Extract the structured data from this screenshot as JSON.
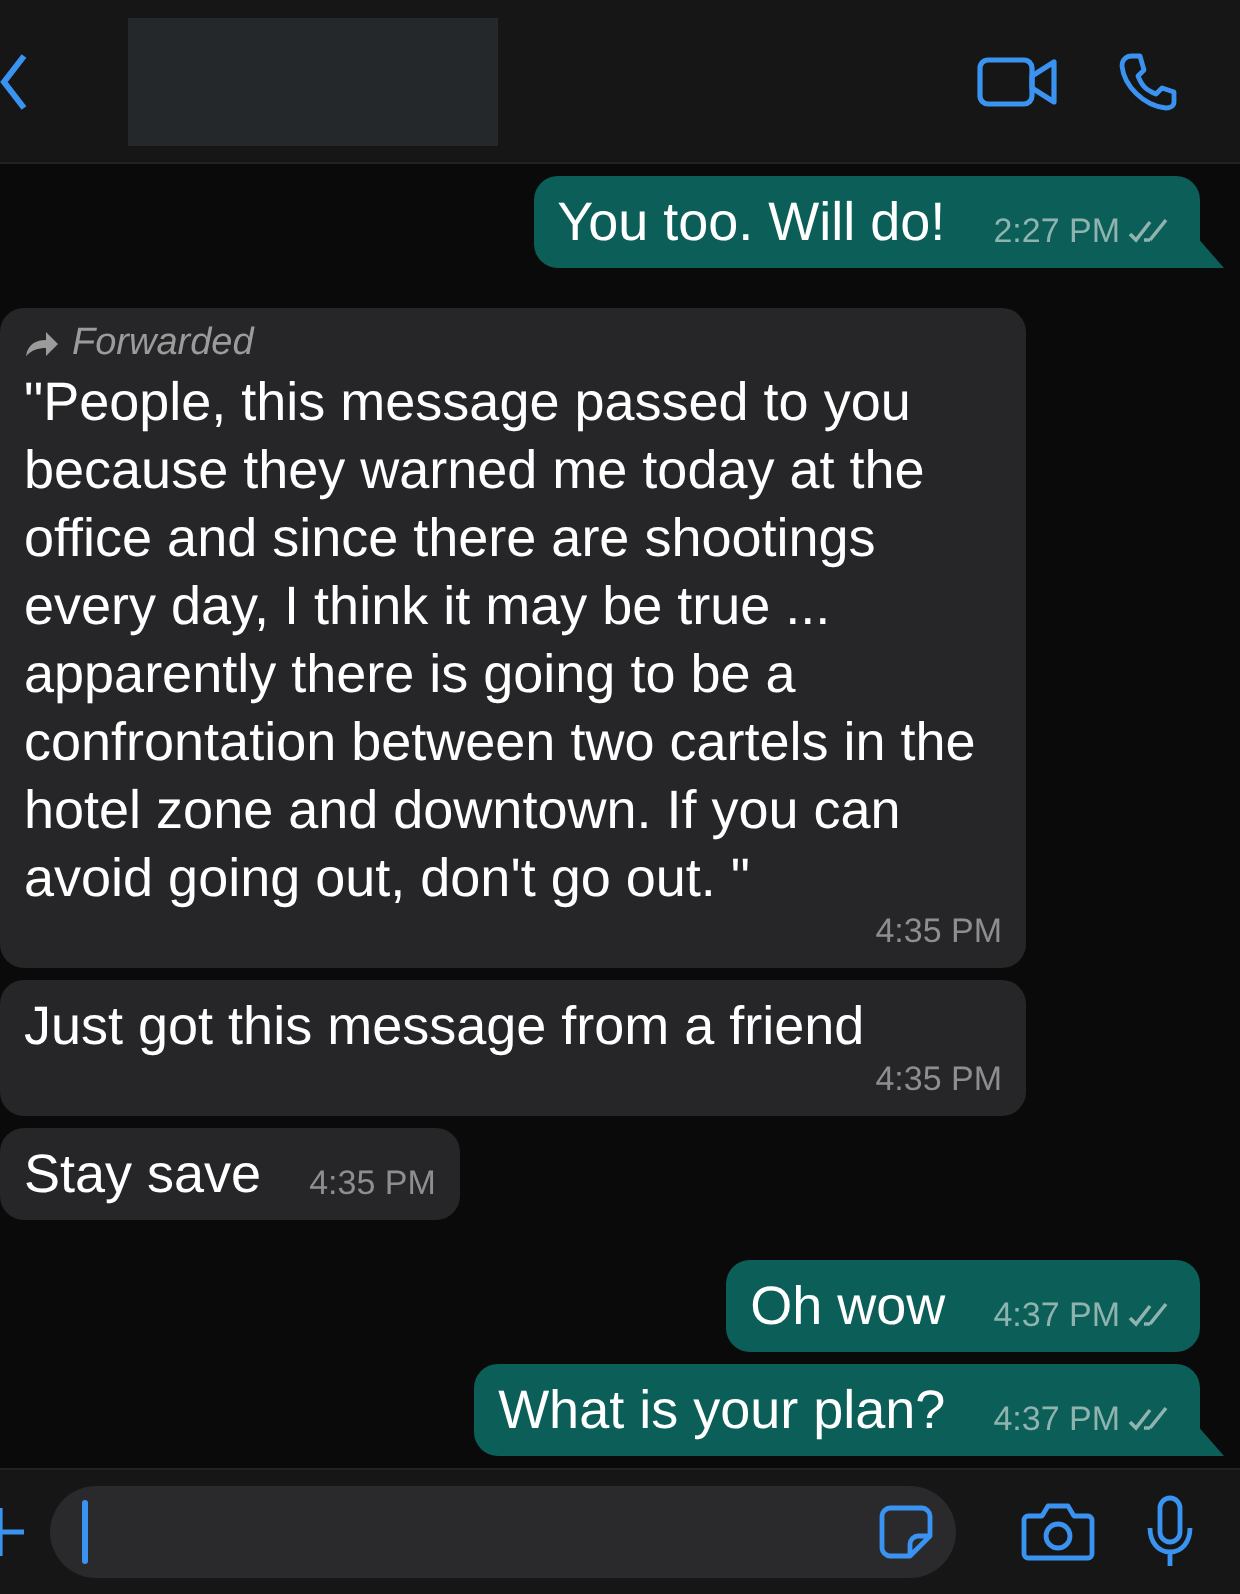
{
  "messages": [
    {
      "kind": "outgoing",
      "text": "You too. Will do!",
      "time": "2:27 PM",
      "read": false,
      "tail": true
    },
    {
      "kind": "incoming",
      "forwarded": "Forwarded",
      "text": "\"People, this message passed to you because they warned me today at the office and since there are shootings every day, I think it may be true ... apparently there is going to be a confrontation between two cartels in the hotel zone and downtown. If you can avoid going out, don't go out. \"",
      "time": "4:35 PM",
      "tail": false
    },
    {
      "kind": "incoming",
      "text": "Just got this message from a friend",
      "time": "4:35 PM",
      "tail": false
    },
    {
      "kind": "incoming",
      "text": "Stay save",
      "time": "4:35 PM",
      "tail": false
    },
    {
      "kind": "outgoing",
      "text": "Oh wow",
      "time": "4:37 PM",
      "read": false,
      "tail": false
    },
    {
      "kind": "outgoing",
      "text": "What is your plan?",
      "time": "4:37 PM",
      "read": false,
      "tail": true
    }
  ]
}
